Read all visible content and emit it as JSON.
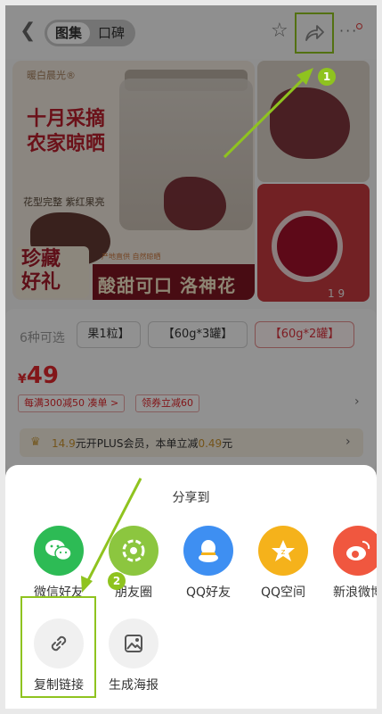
{
  "header": {
    "back_icon": "chevron-left-icon",
    "tabs": [
      {
        "label": "图集",
        "active": true
      },
      {
        "label": "口碑",
        "active": false
      }
    ],
    "favorite_icon": "star-icon",
    "share_icon": "share-arrow-icon",
    "more_icon": "ellipsis-icon"
  },
  "gallery": {
    "brand": "暖白晨光®",
    "headline_line1": "十月采摘",
    "headline_line2": "农家晾晒",
    "feature": "花型完整 紫红果亮",
    "gift_line1": "珍藏",
    "gift_line2": "好礼",
    "origin_tag": "产地直供 自然晾晒",
    "banner": "酸甜可口 洛神花",
    "pager": "1 9"
  },
  "product": {
    "options_label": "6种可选",
    "options": [
      {
        "label": "果1粒】",
        "selected": false
      },
      {
        "label": "【60g*3罐】",
        "selected": false
      },
      {
        "label": "【60g*2罐】",
        "selected": true
      }
    ],
    "price_symbol": "¥",
    "price": "49",
    "promos": [
      "每满300减50 凑单 >",
      "领券立减60"
    ],
    "plus_amount": "14.9",
    "plus_text": "元开PLUS会员，本单立减",
    "plus_saving": "0.49",
    "plus_unit": "元"
  },
  "share_sheet": {
    "title": "分享到",
    "row1": [
      {
        "label": "微信好友",
        "icon": "wechat-icon",
        "color": "#2dbb55"
      },
      {
        "label": "朋友圈",
        "icon": "moments-icon",
        "color": "#8cc63f"
      },
      {
        "label": "QQ好友",
        "icon": "qq-icon",
        "color": "#3e8ff2"
      },
      {
        "label": "QQ空间",
        "icon": "qzone-icon",
        "color": "#f5b21b"
      },
      {
        "label": "新浪微博",
        "icon": "weibo-icon",
        "color": "#f0573f"
      }
    ],
    "row2": [
      {
        "label": "复制链接",
        "icon": "link-icon"
      },
      {
        "label": "生成海报",
        "icon": "poster-icon"
      }
    ]
  },
  "annotations": {
    "step1": "1",
    "step2": "2",
    "accent": "#8fc31f"
  }
}
